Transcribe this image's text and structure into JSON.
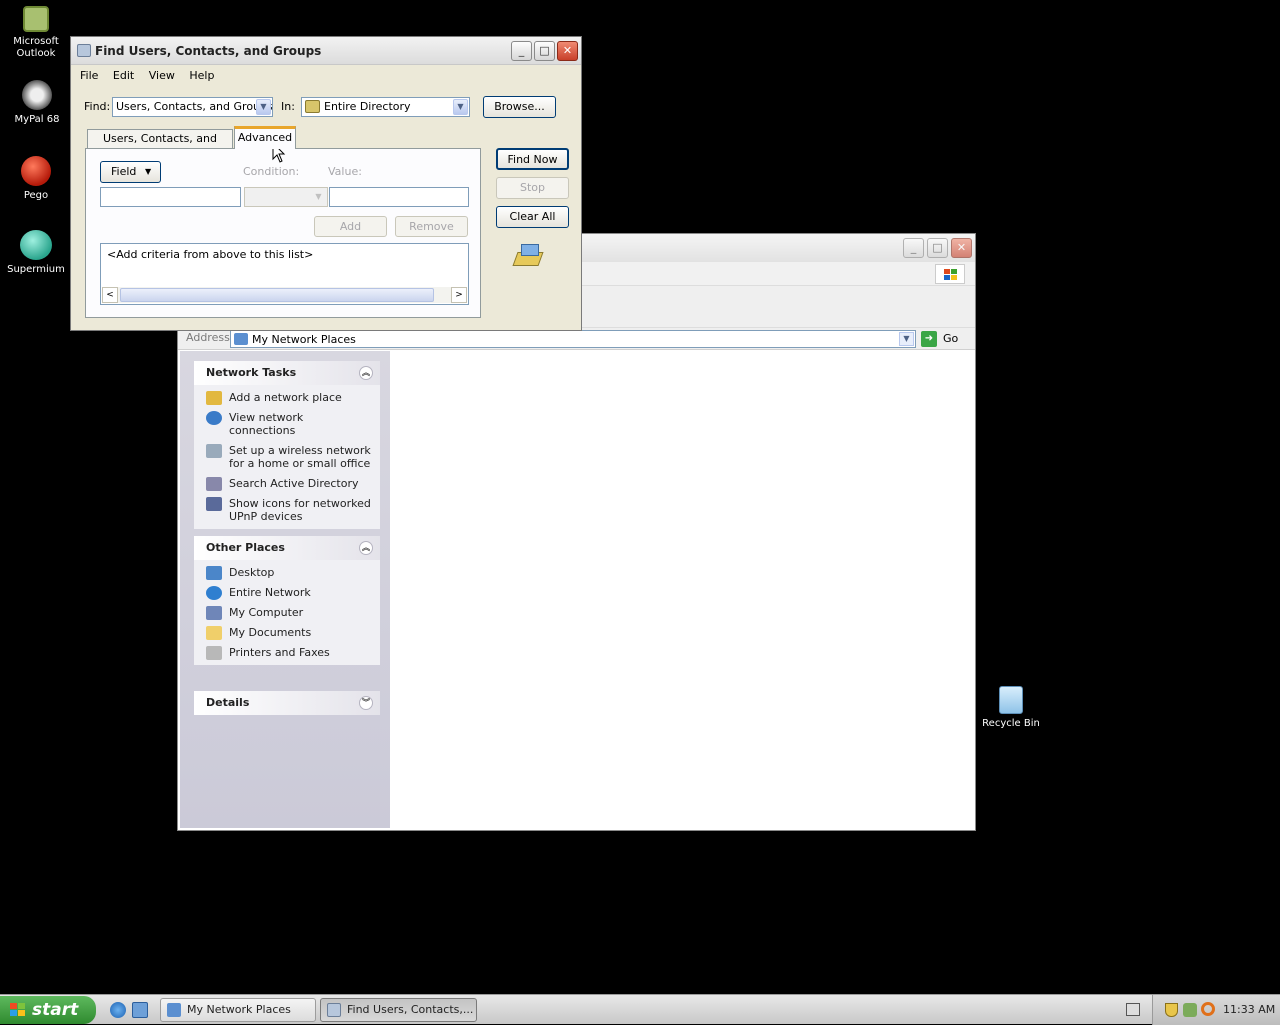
{
  "desktop": {
    "icons": [
      {
        "label_line1": "Microsoft",
        "label_line2": "Outlook"
      },
      {
        "label_line1": "MyPal 68",
        "label_line2": ""
      },
      {
        "label_line1": "Pego",
        "label_line2": ""
      },
      {
        "label_line1": "Supermium",
        "label_line2": ""
      },
      {
        "label_line1": "Recycle Bin",
        "label_line2": ""
      }
    ]
  },
  "find_dialog": {
    "title": "Find Users, Contacts, and Groups",
    "menu": [
      "File",
      "Edit",
      "View",
      "Help"
    ],
    "find_label": "Find:",
    "find_value": "Users, Contacts, and Groups",
    "in_label": "In:",
    "in_value": "Entire Directory",
    "browse": "Browse...",
    "tabs": [
      "Users, Contacts, and Groups",
      "Advanced"
    ],
    "field_button": "Field",
    "condition_label": "Condition:",
    "value_label": "Value:",
    "add": "Add",
    "remove": "Remove",
    "criteria_placeholder": "<Add criteria from above to this list>",
    "find_now": "Find Now",
    "stop": "Stop",
    "clear_all": "Clear All"
  },
  "explorer": {
    "address_label": "Address",
    "address_value": "My Network Places",
    "go": "Go",
    "network_tasks": {
      "title": "Network Tasks",
      "items": [
        {
          "line1": "Add a network place",
          "line2": ""
        },
        {
          "line1": "View network connections",
          "line2": ""
        },
        {
          "line1": "Set up a wireless network",
          "line2": "for a home or small office"
        },
        {
          "line1": "Search Active Directory",
          "line2": ""
        },
        {
          "line1": "Show icons for networked",
          "line2": "UPnP devices"
        }
      ]
    },
    "other_places": {
      "title": "Other Places",
      "items": [
        "Desktop",
        "Entire Network",
        "My Computer",
        "My Documents",
        "Printers and Faxes"
      ]
    },
    "details": {
      "title": "Details"
    }
  },
  "taskbar": {
    "start": "start",
    "tasks": [
      "My Network Places",
      "Find Users, Contacts,..."
    ],
    "clock": "11:33 AM"
  }
}
